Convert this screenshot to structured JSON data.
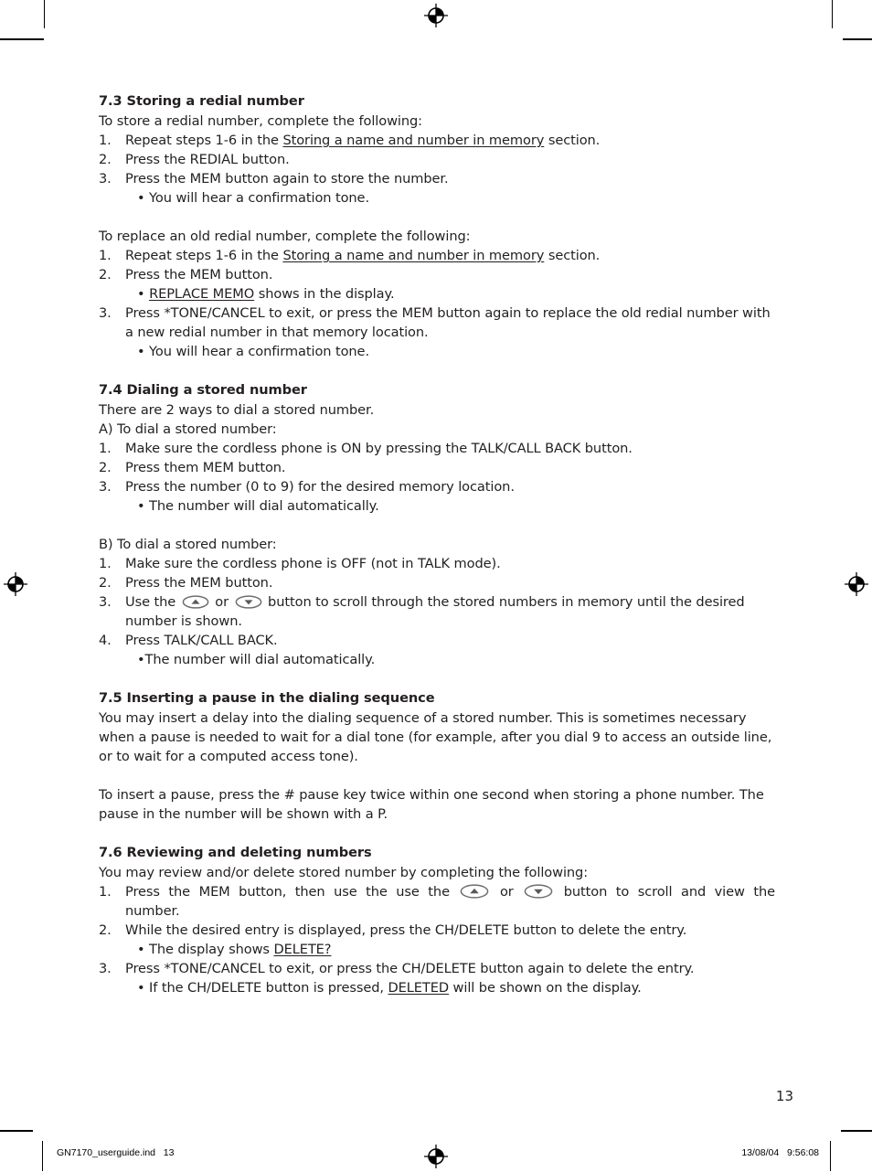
{
  "document": {
    "page_number": "13",
    "footer": {
      "file_label": "GN7170_userguide.ind   13",
      "timestamp": "13/08/04   9:56:08"
    }
  },
  "sections": {
    "s73": {
      "title": "7.3 Storing a redial number",
      "intro": "To store a redial number, complete the following:",
      "items": [
        {
          "num": "1.",
          "pre": "Repeat steps 1-6 in the ",
          "link": "Storing a name and number in memory",
          "post": " section."
        },
        {
          "num": "2.",
          "pre": "Press the REDIAL button.",
          "link": "",
          "post": ""
        },
        {
          "num": "3.",
          "pre": "Press the MEM button again to store the number.",
          "link": "",
          "post": ""
        }
      ],
      "bullet1": "• You will hear a confirmation tone.",
      "intro2": "To replace an old redial number, complete the following:",
      "items2": [
        {
          "num": "1.",
          "pre": "Repeat steps 1-6 in the ",
          "link": "Storing a name and number in memory",
          "post": " section."
        },
        {
          "num": "2.",
          "pre": "Press the MEM button.",
          "link": "",
          "post": ""
        }
      ],
      "bullet2_pre": "• ",
      "bullet2_link": "REPLACE MEMO",
      "bullet2_post": " shows in the display.",
      "item3_num": "3.",
      "item3_text": "Press *TONE/CANCEL to exit, or press the MEM button again to replace the old redial number with a new redial number in that memory location.",
      "bullet3": "• You will hear a confirmation tone."
    },
    "s74": {
      "title": "7.4 Dialing a stored number",
      "intro": "There are 2 ways to dial a stored number.",
      "subhead_a": "A) To dial a stored number:",
      "items_a": [
        {
          "num": "1.",
          "text": "Make sure the cordless phone is ON by pressing the TALK/CALL BACK button."
        },
        {
          "num": "2.",
          "text": "Press them MEM button."
        },
        {
          "num": "3.",
          "text": "Press the number (0 to 9) for the desired memory location."
        }
      ],
      "bullet_a": "• The number will dial automatically.",
      "subhead_b": "B) To dial a stored number:",
      "items_b": [
        {
          "num": "1.",
          "text": "Make sure the cordless phone is OFF (not in TALK mode)."
        },
        {
          "num": "2.",
          "text": "Press the MEM button."
        }
      ],
      "item_b3_num": "3.",
      "item_b3_pre": "Use the ",
      "item_b3_mid": " or ",
      "item_b3_post": " button to scroll through the stored numbers in memory until the desired number is shown.",
      "item_b4_num": "4.",
      "item_b4_text": "Press TALK/CALL BACK.",
      "bullet_b": "•The number will dial automatically."
    },
    "s75": {
      "title": "7.5 Inserting a pause in the dialing sequence",
      "para1": "You may insert a delay into the dialing sequence of a stored number. This is sometimes necessary when a pause is needed to wait for a dial tone (for example, after you dial 9 to access an outside line, or to wait for a computed access tone).",
      "para2": "To insert a pause, press the # pause key twice within one second when storing a phone number. The pause in the number will be shown with a P."
    },
    "s76": {
      "title": "7.6 Reviewing and deleting numbers",
      "intro": "You may review and/or delete stored number by completing the following:",
      "item1_num": "1.",
      "item1_pre": "Press the MEM button, then use the use the ",
      "item1_mid": " or ",
      "item1_post": " button to scroll and view the",
      "item1_last": "number.",
      "item2_num": "2.",
      "item2_text": "While the desired entry is displayed, press the CH/DELETE button to delete the entry.",
      "bullet2_pre": "• The display shows ",
      "bullet2_link": "DELETE?",
      "item3_num": "3.",
      "item3_text": "Press *TONE/CANCEL to exit, or press the CH/DELETE button again to delete the entry.",
      "bullet3_pre": "• If the CH/DELETE button is pressed, ",
      "bullet3_link": "DELETED",
      "bullet3_post": " will be shown on the display."
    }
  },
  "icons": {
    "scroll_up": "scroll-up-oval-icon",
    "scroll_down": "scroll-down-oval-icon",
    "registration": "registration-target-icon"
  }
}
